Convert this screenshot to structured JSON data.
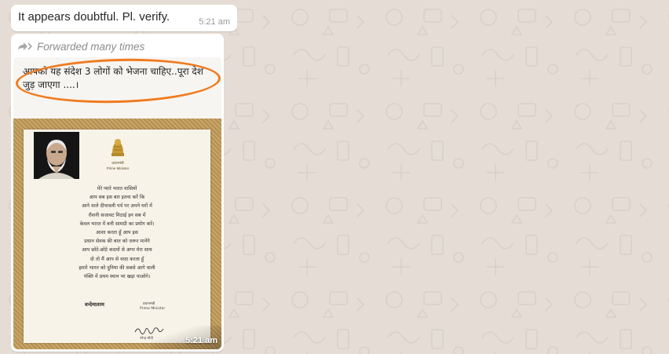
{
  "messages": [
    {
      "text": "It appears doubtful. Pl. verify.",
      "time": "5:21 am"
    }
  ],
  "media_message": {
    "forwarded_label": "Forwarded many times",
    "time": "5:21 am",
    "image_caption": "आपको यह संदेश 3 लोगों को भेजना चाहिए..पूरा देश जुड़ जाएगा ....।",
    "letter": {
      "emblem_caption": "प्रधानमंत्री",
      "emblem_caption_en": "Prime Minister",
      "lines": [
        "मेरे प्यारे भारत वासियों",
        "आप सब इस बार इतना करें कि",
        "आने वाले दीपावली पर्व पर अपने घरों में",
        "रौशनी सजावट मिठाई इन सब में",
        "केवल भारत में बनी सामग्री का प्रयोग करें।",
        "आशा करता हूँ आप इस",
        "प्रधान सेवक की बात को जरूर मानेंगे",
        "आप छोटे-छोटे कदमों से अगर मेरा साथ",
        "दो तो मैं आप से वादा करता हूँ",
        "हमारे भारत को दुनिया की सबसे आगे वाली",
        "पंक्ति में प्रथम स्थान पर खड़ा पाओगे।"
      ],
      "sign_off": "वन्देमातरम",
      "designation": "प्रधानमंत्री",
      "designation_en": "Prime Minister",
      "name_line": "नरेन्द्र मोदी"
    }
  },
  "colors": {
    "chat_background": "#e5ddd5",
    "bubble": "#ffffff",
    "highlight_oval": "#ef7b1f"
  },
  "icons": {
    "forwarded": "forward-arrows-icon"
  }
}
